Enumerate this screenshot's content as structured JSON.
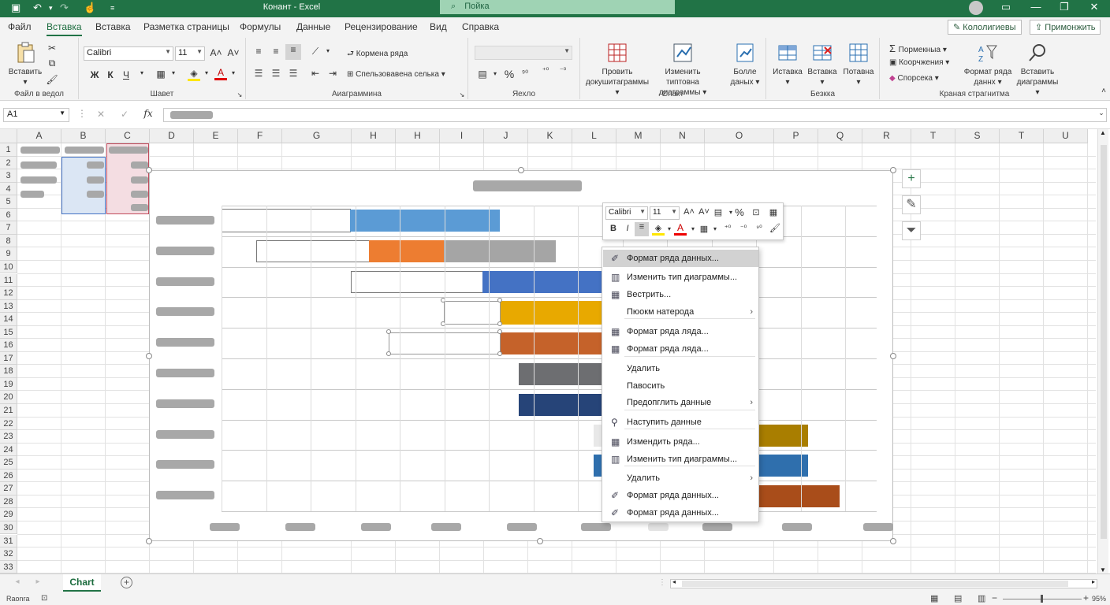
{
  "titlebar": {
    "doc_title": "Конант - Excel",
    "search_placeholder": "Пойка"
  },
  "menu": {
    "tabs": [
      "Файл",
      "Вставка",
      "Вставка",
      "Разметка страницы",
      "Формулы",
      "Данные",
      "Рецензирование",
      "Вид",
      "Справка"
    ],
    "right_buttons": [
      "Кололигиевы",
      "Примонжить"
    ]
  },
  "ribbon": {
    "clipboard": {
      "paste_label": "Вставить",
      "group_label": "Файл в ведол"
    },
    "font": {
      "font_name": "Calibri",
      "font_size": "11",
      "bold": "Ж",
      "italic": "К",
      "underline": "Ч",
      "group_label": "Шавет"
    },
    "alignment": {
      "wrap_label": "Кормена ряда",
      "merge_label": "Спельзовавена селька",
      "group_label": "Аиаграммина"
    },
    "number": {
      "format_value": "",
      "group_label": "Яехло"
    },
    "chart": {
      "b1": "Провить докушитаграммы",
      "b2": "Изменить типтовна диаграммы",
      "b3": "Болле даных",
      "group_label": "Спакт"
    },
    "cells": {
      "b1": "Иставка",
      "b2": "Вставка",
      "b3": "Потавна",
      "group_label": "Безкка"
    },
    "editing": {
      "s1": "Пормекныа",
      "s2": "Коорчжения",
      "s3": "Спорсека",
      "b1": "Формат ряда даннх",
      "b2": "Вставить диаграммы",
      "group_label": "Краная страгнитма"
    }
  },
  "formula_bar": {
    "name_box": "A1",
    "fx": "fx"
  },
  "columns": [
    "A",
    "B",
    "C",
    "D",
    "E",
    "F",
    "G",
    "H",
    "H",
    "I",
    "J",
    "K",
    "L",
    "M",
    "N",
    "O",
    "P",
    "Q",
    "R",
    "T",
    "S",
    "T",
    "U"
  ],
  "rows": [
    "1",
    "2",
    "3",
    "4",
    "5",
    "6",
    "7",
    "8",
    "9",
    "10",
    "11",
    "12",
    "13",
    "14",
    "15",
    "16",
    "17",
    "18",
    "19",
    "20",
    "21",
    "22",
    "23",
    "24",
    "25",
    "26",
    "27",
    "28",
    "29",
    "30",
    "31",
    "32",
    "33"
  ],
  "colors": {
    "accent": "#217346",
    "bar_blue": "#5b9bd5",
    "bar_orange": "#ed7d31",
    "bar_gray": "#a5a5a5",
    "bar_dark_blue": "#4472c4",
    "bar_gold": "#e8a900",
    "bar_rust": "#c5622a",
    "bar_slate": "#6d6e71",
    "bar_navy": "#264478",
    "bar_olive": "#a97e00",
    "bar_steel": "#2f6fad",
    "bar_brown": "#a94d1a"
  },
  "mini_toolbar": {
    "font": "Calibri",
    "size": "11",
    "bold": "B",
    "italic": "I"
  },
  "context_menu": [
    {
      "label": "Формат ряда данных...",
      "icon": "paint-icon",
      "hover": true
    },
    {
      "label": "Изменить тип диаграммы...",
      "icon": "chart-icon"
    },
    {
      "label": "Вестрить...",
      "icon": "table-icon"
    },
    {
      "label": "Пюокм натерода",
      "icon": "",
      "submenu": true
    },
    {
      "label": "Формат ряда ляда...",
      "icon": "table-icon"
    },
    {
      "label": "Формат ряда ляда...",
      "icon": "table-icon"
    },
    {
      "label": "Удалить",
      "icon": ""
    },
    {
      "label": "Павосить",
      "icon": ""
    },
    {
      "label": "Предопглить данные",
      "icon": "",
      "submenu": true
    },
    {
      "label": "Наступить данные",
      "icon": "link-icon"
    },
    {
      "label": "Измендить ряда...",
      "icon": "table-icon"
    },
    {
      "label": "Изменить тип диаграммы...",
      "icon": "chart-icon"
    },
    {
      "label": "Удалить",
      "icon": "",
      "submenu": true
    },
    {
      "label": "Формат ряда данных...",
      "icon": "paint-icon"
    },
    {
      "label": "Формат ряда данных...",
      "icon": "paint-icon"
    }
  ],
  "sheet_tabs": [
    "Chart"
  ],
  "status": {
    "left": "Raonra",
    "zoom": "95%"
  }
}
